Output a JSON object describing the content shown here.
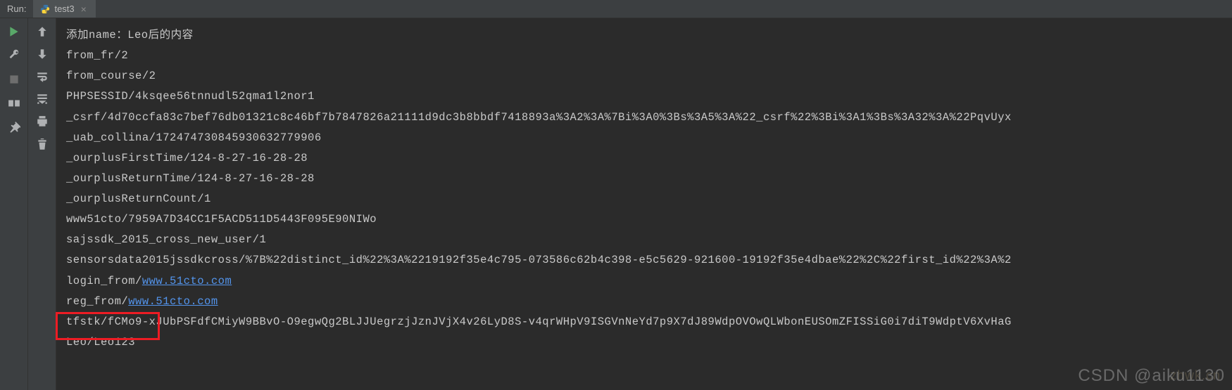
{
  "header": {
    "run_label": "Run:",
    "tab_name": "test3",
    "tab_close": "×"
  },
  "console": {
    "lines": [
      {
        "text": "添加name：Leo后的内容"
      },
      {
        "text": "from_fr/2"
      },
      {
        "text": "from_course/2"
      },
      {
        "text": "PHPSESSID/4ksqee56tnnudl52qma1l2nor1"
      },
      {
        "text": "_csrf/4d70ccfa83c7bef76db01321c8c46bf7b7847826a21111d9dc3b8bbdf7418893a%3A2%3A%7Bi%3A0%3Bs%3A5%3A%22_csrf%22%3Bi%3A1%3Bs%3A32%3A%22PqvUyx"
      },
      {
        "text": "_uab_collina/172474730845930632779906"
      },
      {
        "text": "_ourplusFirstTime/124-8-27-16-28-28"
      },
      {
        "text": "_ourplusReturnTime/124-8-27-16-28-28"
      },
      {
        "text": "_ourplusReturnCount/1"
      },
      {
        "text": "www51cto/7959A7D34CC1F5ACD511D5443F095E90NIWo"
      },
      {
        "text": "sajssdk_2015_cross_new_user/1"
      },
      {
        "text": "sensorsdata2015jssdkcross/%7B%22distinct_id%22%3A%2219192f35e4c795-073586c62b4c398-e5c5629-921600-19192f35e4dbae%22%2C%22first_id%22%3A%2"
      },
      {
        "prefix": "login_from/",
        "link": "www.51cto.com"
      },
      {
        "prefix": "reg_from/",
        "link": "www.51cto.com"
      },
      {
        "text": "tfstk/fCMo9-xJUbPSFdfCMiyW9BBvO-O9egwQg2BLJJUegrzjJznJVjX4v26LyD8S-v4qrWHpV9ISGVnNeYd7p9X7dJ89WdpOVOwQLWbonEUSOmZFISSiG0i7diT9WdptV6XvHaG"
      },
      {
        "text": "Leo/Leo123"
      }
    ]
  },
  "watermark": "CSDN @aiku1130",
  "watermark2": "zhwk.cn"
}
